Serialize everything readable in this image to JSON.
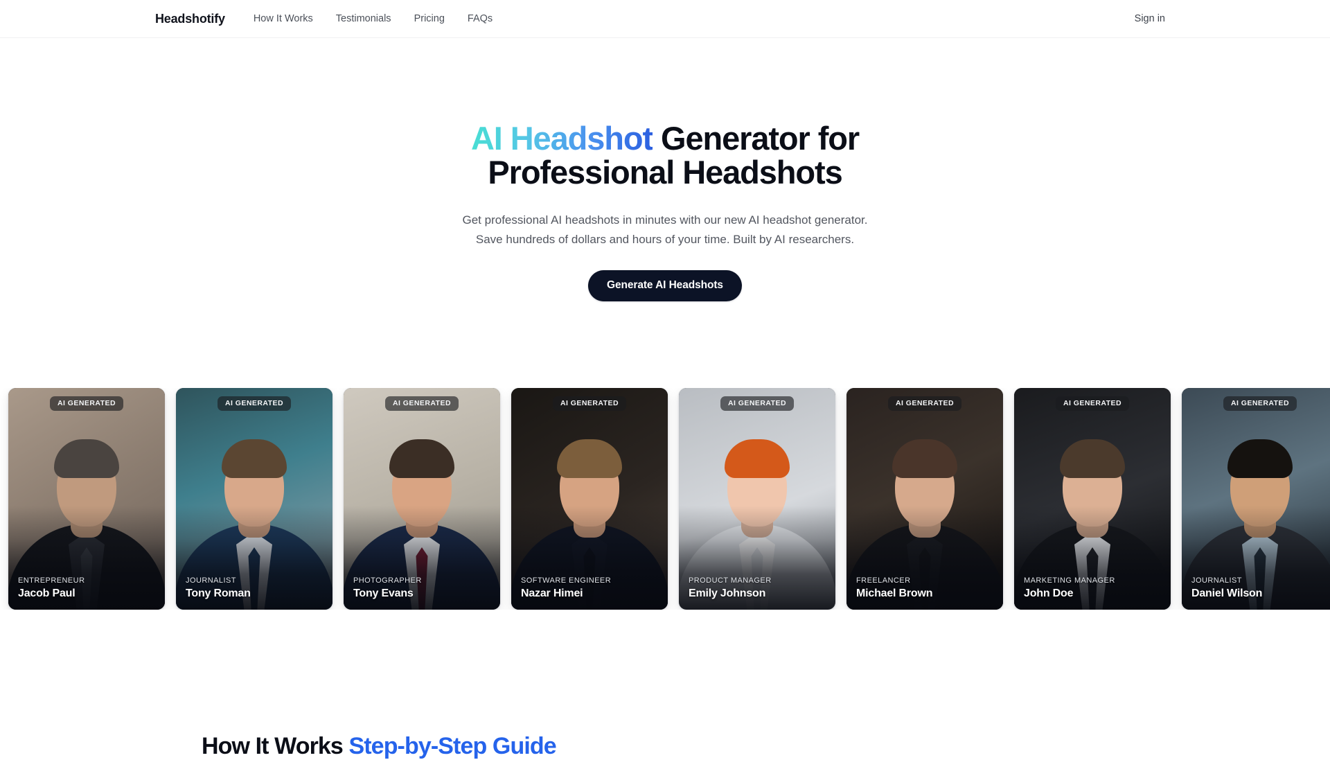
{
  "nav": {
    "brand": "Headshotify",
    "links": [
      {
        "label": "How It Works"
      },
      {
        "label": "Testimonials"
      },
      {
        "label": "Pricing"
      },
      {
        "label": "FAQs"
      }
    ],
    "signin_label": "Sign in"
  },
  "hero": {
    "title_accent": "AI Headshot",
    "title_rest": " Generator for Professional Headshots",
    "subtitle_line1": "Get professional AI headshots in minutes with our new AI headshot generator.",
    "subtitle_line2": "Save hundreds of dollars and hours of your time. Built by AI researchers.",
    "cta_label": "Generate AI Headshots",
    "accent_gradient_from": "#48ded3",
    "accent_gradient_to": "#2b5fe0",
    "cta_bg": "#0c1326"
  },
  "gallery": {
    "badge_label": "AI GENERATED",
    "cards": [
      {
        "role": "ENTREPRENEUR",
        "name": "Jacob Paul",
        "bg": "linear-gradient(150deg,#a9998a 0%,#8e7f72 45%,#6d6158 100%)",
        "skin": "#c09a7e",
        "hair": "#4a4440",
        "suit": "#15171c",
        "shirt": "#2a2d34",
        "tie": "#3b3f46"
      },
      {
        "role": "JOURNALIST",
        "name": "Tony Roman",
        "bg": "linear-gradient(160deg,#2f545c 0%,#3f7f8d 40%,#9aa5ac 100%)",
        "skin": "#d8a88a",
        "hair": "#5b4632",
        "suit": "#1d3a5c",
        "shirt": "#e9eef4",
        "tie": "#1d3a5c"
      },
      {
        "role": "PHOTOGRAPHER",
        "name": "Tony Evans",
        "bg": "linear-gradient(160deg,#cfc9bf 0%,#b8b2a6 50%,#9a958b 100%)",
        "skin": "#d9a483",
        "hair": "#3b2e25",
        "suit": "#1b2b4a",
        "shirt": "#f2f4f7",
        "tie": "#7c1f35"
      },
      {
        "role": "SOFTWARE ENGINEER",
        "name": "Nazar Himei",
        "bg": "linear-gradient(150deg,#1a1714 0%,#2b2521 55%,#4a3f36 100%)",
        "skin": "#d6a382",
        "hair": "#7c5e3c",
        "suit": "#101522",
        "shirt": "#131826",
        "tie": "#0d111b"
      },
      {
        "role": "PRODUCT MANAGER",
        "name": "Emily Johnson",
        "bg": "linear-gradient(160deg,#b9bdc2 0%,#d6d9dd 55%,#8f949a 100%)",
        "skin": "#f0c6ad",
        "hair": "#d4591a",
        "suit": "#e8ebef",
        "shirt": "#ffffff",
        "tie": "#e8ebef"
      },
      {
        "role": "FREELANCER",
        "name": "Michael Brown",
        "bg": "linear-gradient(155deg,#2a2320 0%,#3b322b 45%,#16120f 100%)",
        "skin": "#d6a98c",
        "hair": "#4a352a",
        "suit": "#15161a",
        "shirt": "#1b1d22",
        "tie": "#15161a"
      },
      {
        "role": "MARKETING MANAGER",
        "name": "John Doe",
        "bg": "linear-gradient(160deg,#1a1b1e 0%,#2c2e33 50%,#0f1012 100%)",
        "skin": "#dcb094",
        "hair": "#4b3a2c",
        "suit": "#16181c",
        "shirt": "#f3f5f8",
        "tie": "#24262b"
      },
      {
        "role": "JOURNALIST",
        "name": "Daniel Wilson",
        "bg": "linear-gradient(160deg,#3c4a55 0%,#5e7380 45%,#222a31 100%)",
        "skin": "#cf9f78",
        "hair": "#15120f",
        "suit": "#2d3138",
        "shirt": "#bcd2e0",
        "tie": "#2b3a46"
      }
    ]
  },
  "howitworks": {
    "heading_plain": "How It Works ",
    "heading_accent": "Step-by-Step Guide",
    "accent_color": "#2563eb"
  }
}
